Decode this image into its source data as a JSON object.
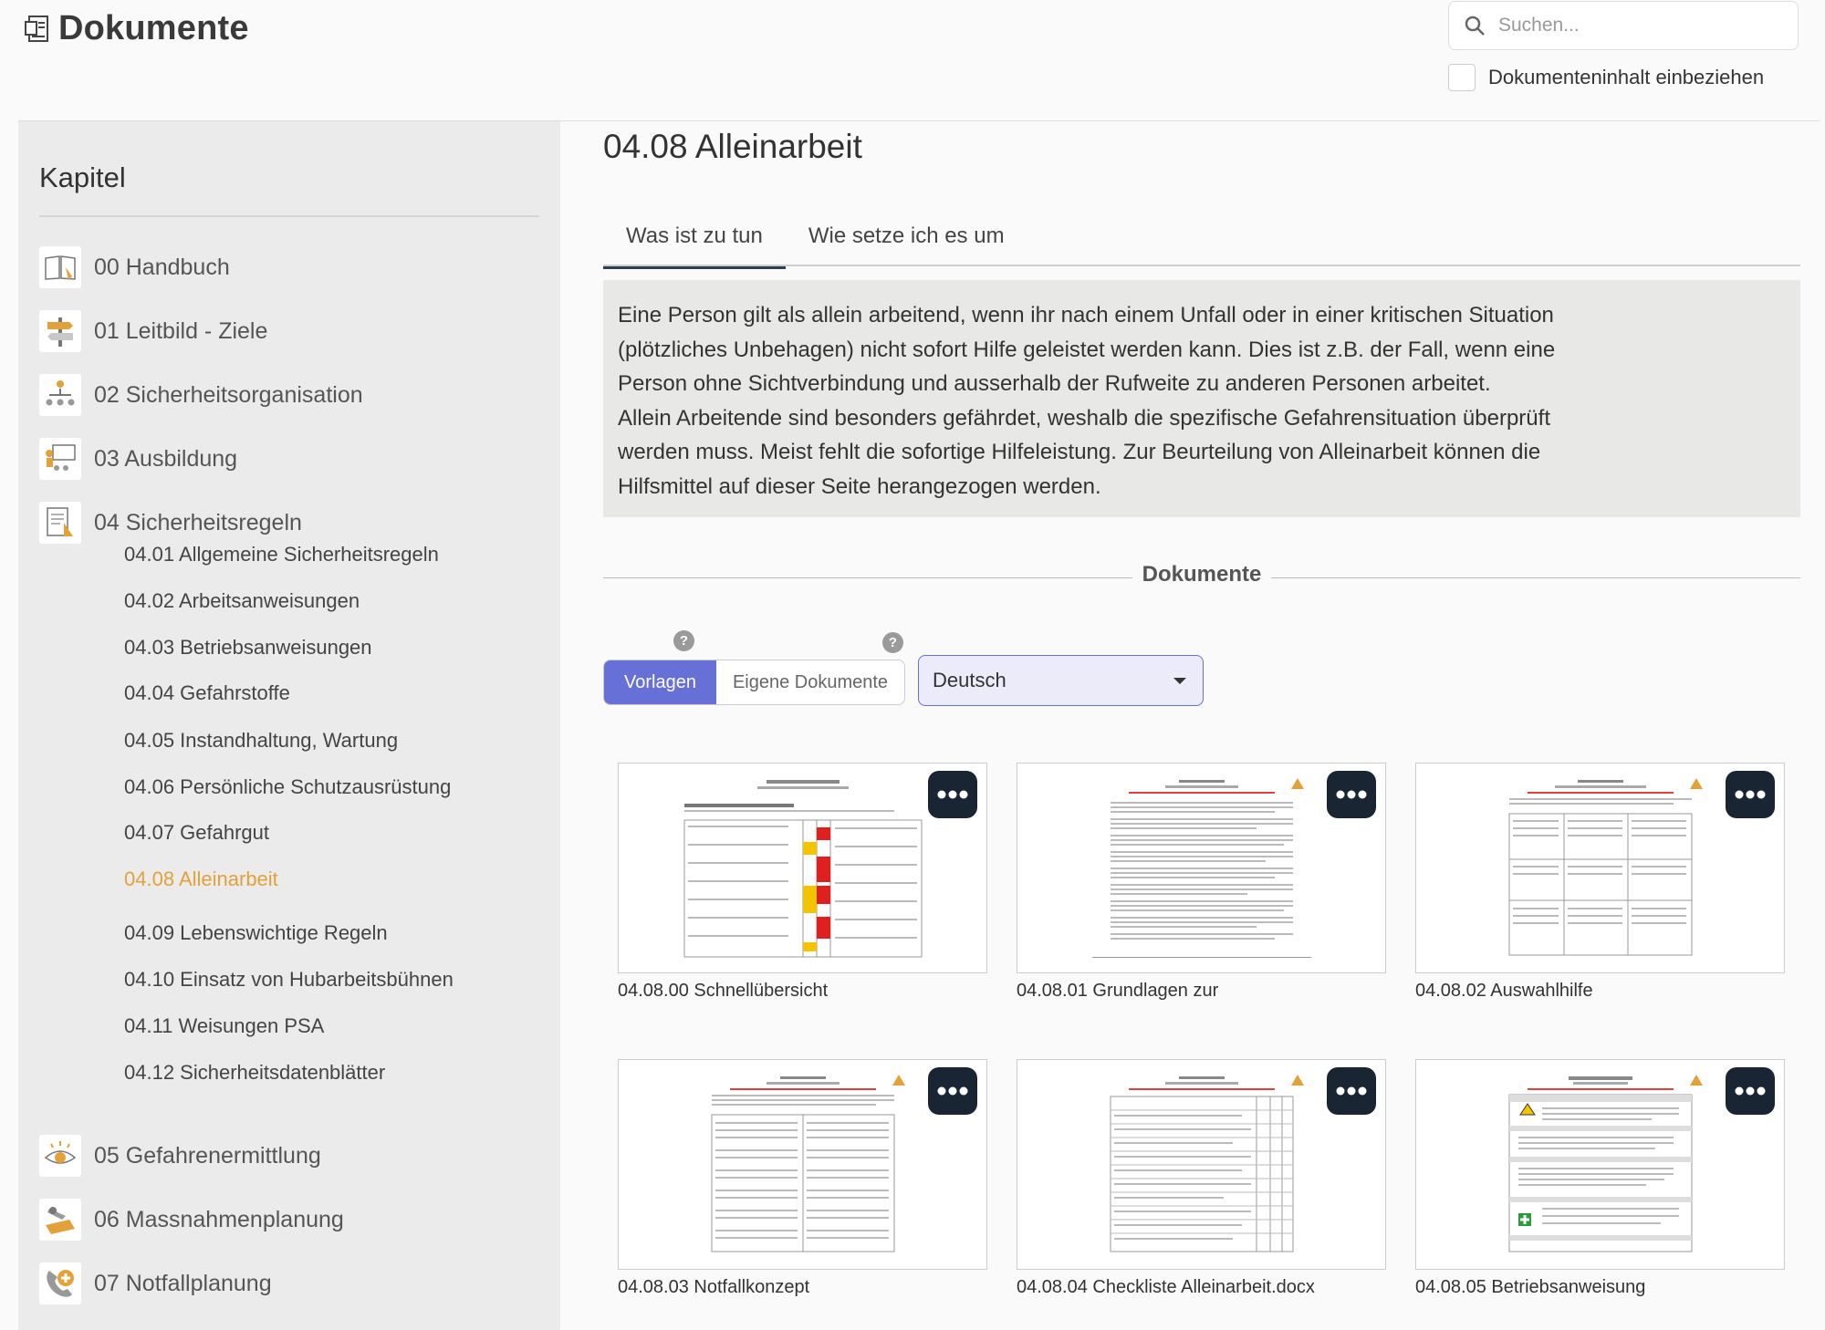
{
  "app": {
    "title": "Dokumente"
  },
  "search": {
    "placeholder": "Suchen...",
    "include_content_label": "Dokumenteninhalt einbeziehen"
  },
  "sidebar": {
    "title": "Kapitel",
    "chapters": [
      {
        "label": "00 Handbuch",
        "icon": "book-icon"
      },
      {
        "label": "01 Leitbild - Ziele",
        "icon": "signpost-icon"
      },
      {
        "label": "02 Sicherheitsorganisation",
        "icon": "org-chart-icon"
      },
      {
        "label": "03 Ausbildung",
        "icon": "presentation-icon"
      },
      {
        "label": "04 Sicherheitsregeln",
        "icon": "rules-document-icon"
      },
      {
        "label": "05 Gefahrenermittlung",
        "icon": "eye-icon"
      },
      {
        "label": "06 Massnahmenplanung",
        "icon": "planning-icon"
      },
      {
        "label": "07 Notfallplanung",
        "icon": "emergency-phone-icon"
      }
    ],
    "sub_items": [
      {
        "label": "04.01 Allgemeine Sicherheitsregeln",
        "active": false
      },
      {
        "label": "04.02 Arbeitsanweisungen",
        "active": false
      },
      {
        "label": "04.03 Betriebsanweisungen",
        "active": false
      },
      {
        "label": "04.04 Gefahrstoffe",
        "active": false
      },
      {
        "label": "04.05 Instandhaltung, Wartung",
        "active": false
      },
      {
        "label": "04.06 Persönliche Schutzausrüstung",
        "active": false
      },
      {
        "label": "04.07 Gefahrgut",
        "active": false
      },
      {
        "label": "04.08 Alleinarbeit",
        "active": true
      },
      {
        "label": "04.09 Lebenswichtige Regeln",
        "active": false
      },
      {
        "label": "04.10 Einsatz von Hubarbeitsbühnen",
        "active": false
      },
      {
        "label": "04.11 Weisungen PSA",
        "active": false
      },
      {
        "label": "04.12 Sicherheitsdatenblätter",
        "active": false
      }
    ]
  },
  "main": {
    "title": "04.08 Alleinarbeit",
    "tabs": [
      {
        "label": "Was ist zu tun",
        "active": true
      },
      {
        "label": "Wie setze ich es um",
        "active": false
      }
    ],
    "info_lines": [
      "Eine Person gilt als allein arbeitend, wenn ihr nach einem Unfall oder in einer kritischen Situation",
      "(plötzliches Unbehagen) nicht sofort Hilfe geleistet werden kann. Dies ist z.B. der Fall, wenn eine",
      "Person ohne Sichtverbindung und ausserhalb der Rufweite zu anderen Personen arbeitet.",
      "Allein Arbeitende sind besonders gefährdet, weshalb die spezifische Gefahrensituation überprüft",
      "werden muss. Meist fehlt die sofortige Hilfeleistung. Zur Beurteilung von Alleinarbeit können die",
      "Hilfsmittel auf dieser Seite herangezogen werden."
    ],
    "documents_heading": "Dokumente",
    "help_glyph": "?",
    "segments": {
      "templates": "Vorlagen",
      "own": "Eigene Dokumente"
    },
    "language": {
      "selected": "Deutsch"
    },
    "documents": [
      {
        "caption": "04.08.00 Schnellübersicht"
      },
      {
        "caption": "04.08.01 Grundlagen zur"
      },
      {
        "caption": "04.08.02 Auswahlhilfe"
      },
      {
        "caption": "04.08.03 Notfallkonzept"
      },
      {
        "caption": "04.08.04 Checkliste Alleinarbeit.docx"
      },
      {
        "caption": "04.08.05 Betriebsanweisung"
      }
    ]
  },
  "colors": {
    "accent": "#6770d6",
    "active_nav": "#e3a13a",
    "dark_button": "#1a2533",
    "tab_indicator": "#2c3e55"
  }
}
